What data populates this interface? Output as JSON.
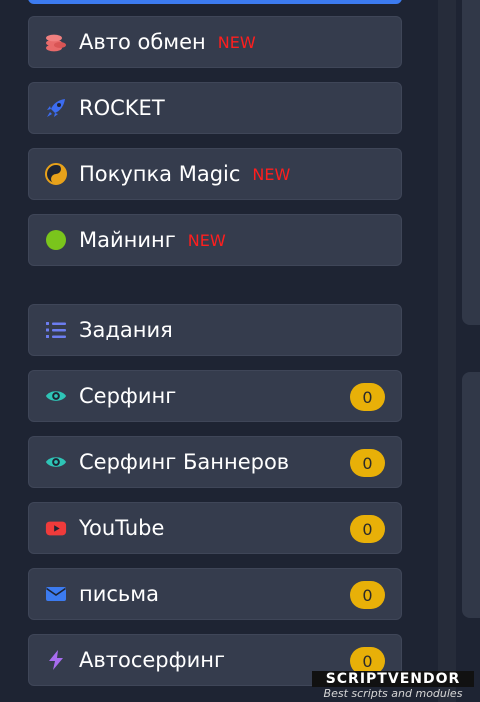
{
  "menu": [
    {
      "label": "Авто обмен",
      "badge": "NEW",
      "icon": "coins-icon"
    },
    {
      "label": "ROCKET",
      "icon": "rocket-icon"
    },
    {
      "label": "Покупка Magic",
      "badge": "NEW",
      "icon": "yin-yang-icon"
    },
    {
      "label": "Майнинг",
      "badge": "NEW",
      "icon": "green-circle-icon"
    },
    {
      "label": "Задания",
      "icon": "list-icon"
    },
    {
      "label": "Серфинг",
      "count": "0",
      "icon": "eye-icon"
    },
    {
      "label": "Серфинг Баннеров",
      "count": "0",
      "icon": "eye-icon"
    },
    {
      "label": "YouTube",
      "count": "0",
      "icon": "youtube-icon"
    },
    {
      "label": "письма",
      "count": "0",
      "icon": "envelope-icon"
    },
    {
      "label": "Автосерфинг",
      "count": "0",
      "icon": "lightning-icon"
    }
  ],
  "colors": {
    "background": "#1e2433",
    "item_bg": "#353c4d",
    "badge_new": "#ff1e1e",
    "count_bg": "#e8b008",
    "top_strip": "#3c7bf0"
  },
  "watermark": {
    "title": "SCRIPTVENDOR",
    "subtitle": "Best scripts and modules"
  }
}
